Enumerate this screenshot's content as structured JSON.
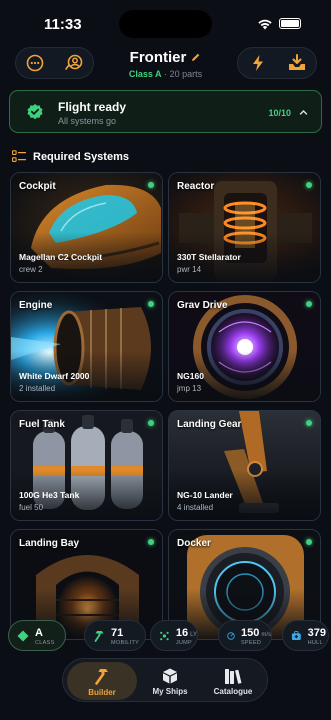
{
  "status_bar": {
    "time": "11:33"
  },
  "header": {
    "ship_name": "Frontier",
    "ship_class": "Class A",
    "parts_count": "· 20 parts"
  },
  "banner": {
    "title": "Flight ready",
    "subtitle": "All systems go",
    "count": "10/10"
  },
  "section": {
    "title": "Required Systems"
  },
  "systems": [
    {
      "name": "Cockpit",
      "part": "Magellan C2 Cockpit",
      "stat": "crew 2",
      "art": "cockpit"
    },
    {
      "name": "Reactor",
      "part": "330T Stellarator",
      "stat": "pwr 14",
      "art": "reactor"
    },
    {
      "name": "Engine",
      "part": "White Dwarf 2000",
      "stat": "2 installed",
      "art": "engine"
    },
    {
      "name": "Grav Drive",
      "part": "NG160",
      "stat": "jmp 13",
      "art": "grav"
    },
    {
      "name": "Fuel Tank",
      "part": "100G He3 Tank",
      "stat": "fuel 50",
      "art": "fuel"
    },
    {
      "name": "Landing Gear",
      "part": "NG-10 Lander",
      "stat": "4 installed",
      "art": "gear"
    },
    {
      "name": "Landing Bay",
      "part": "",
      "stat": "",
      "art": "bay"
    },
    {
      "name": "Docker",
      "part": "",
      "stat": "",
      "art": "docker"
    }
  ],
  "stats": [
    {
      "value": "A",
      "unit": "",
      "key": "CLASS",
      "icon": "diamond-icon"
    },
    {
      "value": "71",
      "unit": "",
      "key": "MOBILITY",
      "icon": "hammer-icon"
    },
    {
      "value": "16",
      "unit": "LY",
      "key": "JUMP",
      "icon": "jump-icon"
    },
    {
      "value": "150",
      "unit": "m/s",
      "key": "SPEED",
      "icon": "speed-icon"
    },
    {
      "value": "379",
      "unit": "",
      "key": "HULL",
      "icon": "hull-icon"
    }
  ],
  "tabs": [
    {
      "label": "Builder",
      "icon": "hammer-icon"
    },
    {
      "label": "My Ships",
      "icon": "cube-icon"
    },
    {
      "label": "Catalogue",
      "icon": "books-icon"
    }
  ],
  "colors": {
    "accent": "#f2a33a",
    "success": "#3fd17e",
    "background": "#0b0f15"
  }
}
